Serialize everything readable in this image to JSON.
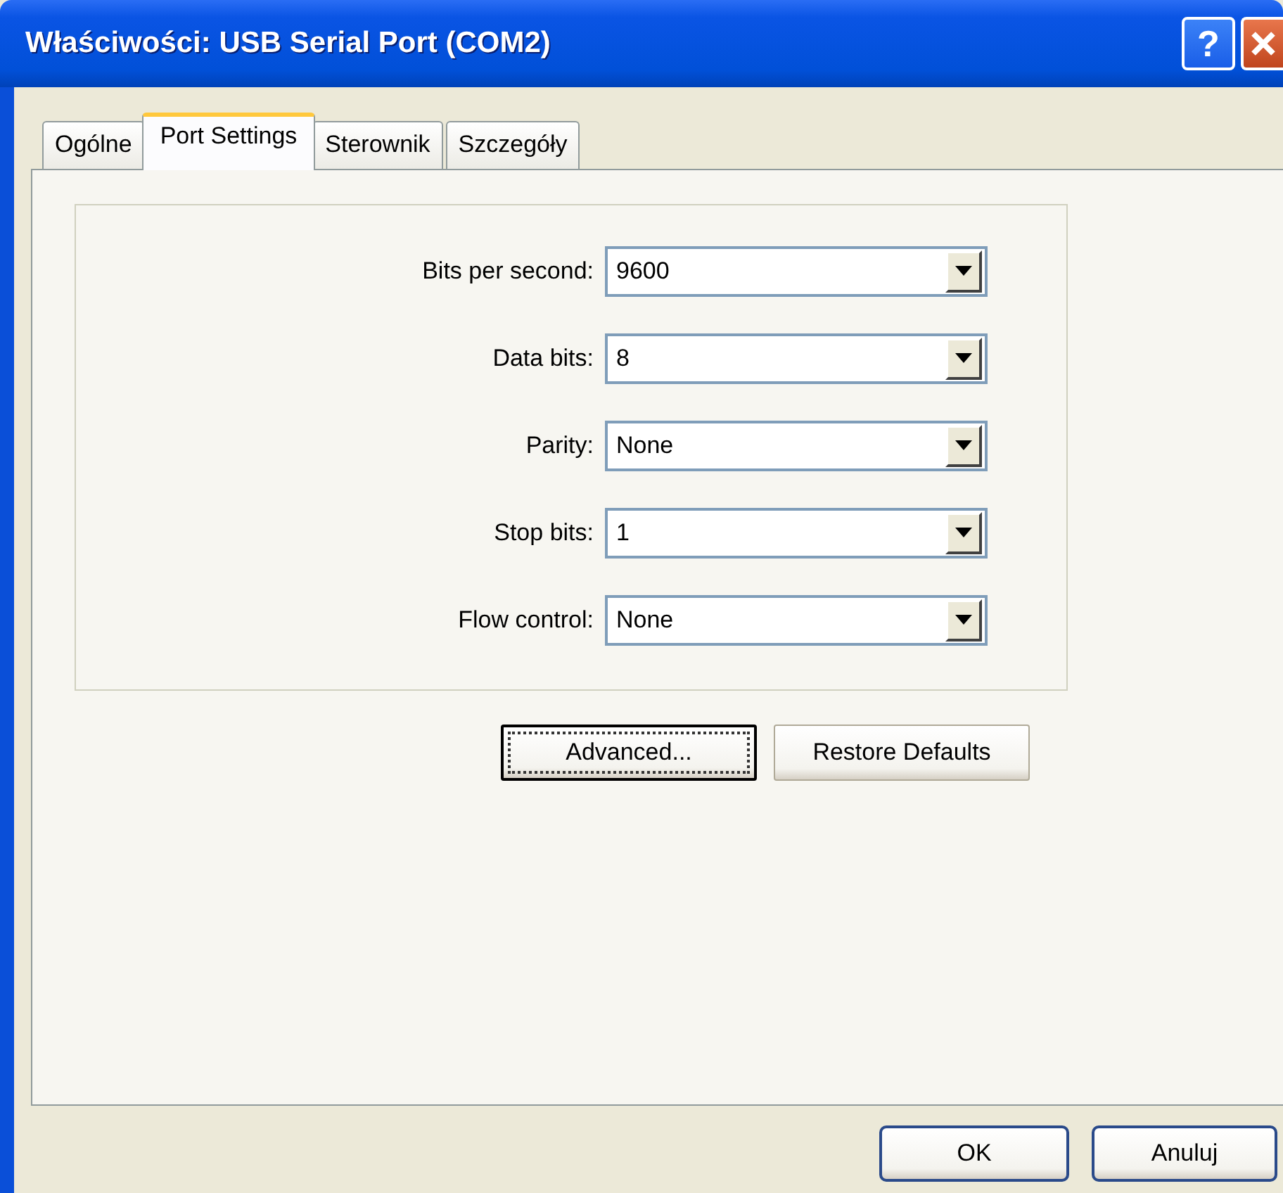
{
  "window": {
    "title": "Właściwości: USB Serial Port (COM2)"
  },
  "title_buttons": [
    {
      "kind": "help",
      "label": "?"
    },
    {
      "kind": "close"
    }
  ],
  "tabs": [
    {
      "label": "Ogólne",
      "selected": false
    },
    {
      "label": "Port Settings",
      "selected": true
    },
    {
      "label": "Sterownik",
      "selected": false
    },
    {
      "label": "Szczegóły",
      "selected": false
    }
  ],
  "fields": [
    {
      "label": "Bits per second:",
      "value": "9600"
    },
    {
      "label": "Data bits:",
      "value": "8"
    },
    {
      "label": "Parity:",
      "value": "None"
    },
    {
      "label": "Stop bits:",
      "value": "1"
    },
    {
      "label": "Flow control:",
      "value": "None"
    }
  ],
  "panel_buttons": [
    {
      "label": "Advanced...",
      "focused": true
    },
    {
      "label": "Restore Defaults",
      "focused": false
    }
  ],
  "dialog_buttons": [
    {
      "label": "OK"
    },
    {
      "label": "Anuluj"
    }
  ]
}
